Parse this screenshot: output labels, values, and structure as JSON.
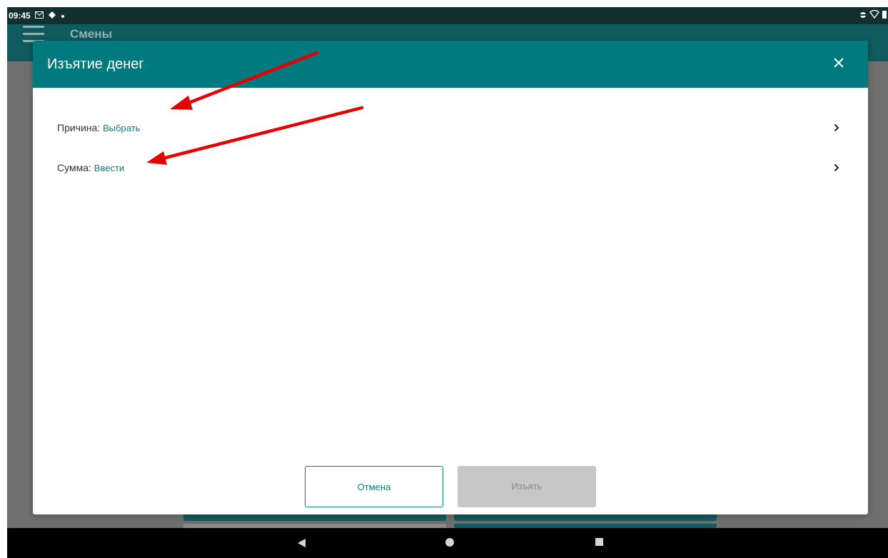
{
  "status_bar": {
    "time": "09:45",
    "left_icons": [
      "gmail-icon",
      "signal-icon",
      "dot-icon"
    ],
    "right_icons": [
      "data-icon",
      "wifi-icon",
      "battery-icon"
    ]
  },
  "app_bar": {
    "title": "Смены"
  },
  "dialog": {
    "title": "Изъятие денег",
    "rows": [
      {
        "label": "Причина: ",
        "value": "Выбрать"
      },
      {
        "label": "Сумма: ",
        "value": "Ввести"
      }
    ],
    "cancel_label": "Отмена",
    "withdraw_label": "Изъять"
  },
  "colors": {
    "accent": "#007a7e",
    "link": "#147b80",
    "annotation_arrow": "#e60000",
    "disabled_button": "#c7c7c7"
  },
  "icons": {
    "close": "close-icon",
    "chevron": "chevron-right-icon",
    "menu": "hamburger-icon"
  }
}
